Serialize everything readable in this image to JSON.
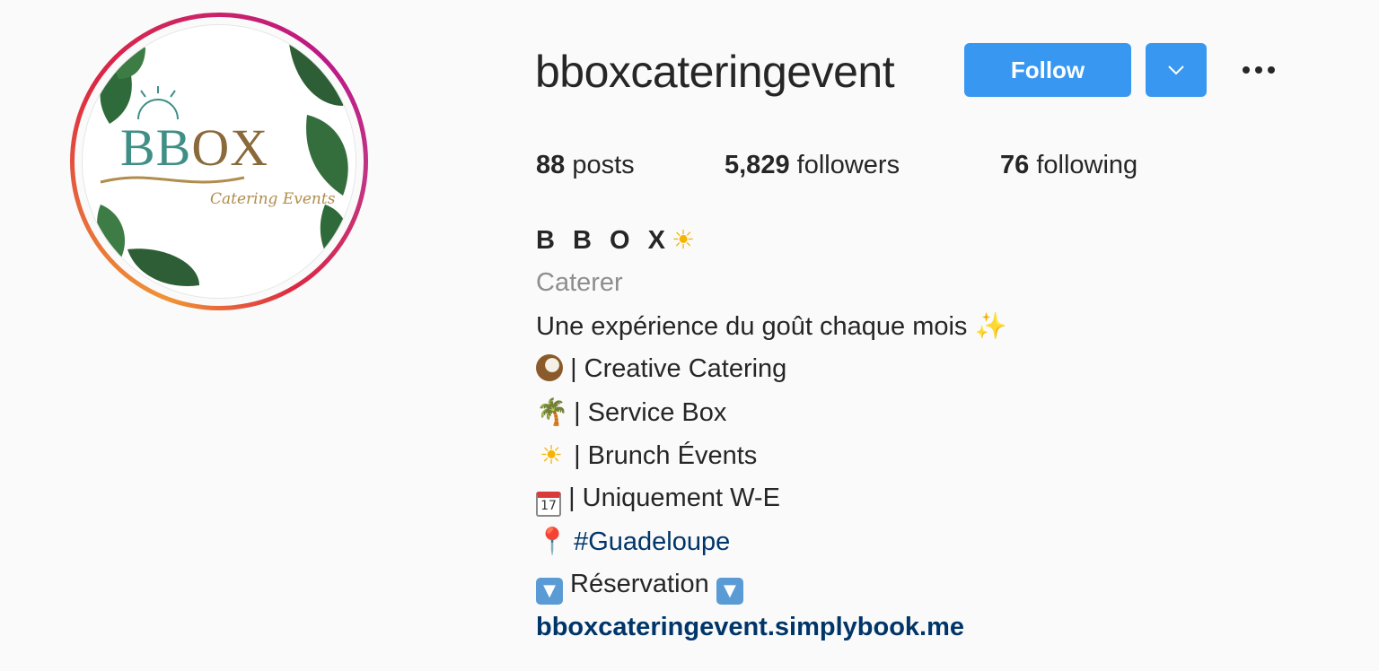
{
  "profile": {
    "username": "bboxcateringevent",
    "avatar": {
      "logo_text_main": "BB",
      "logo_text_accent": "OX",
      "logo_subtitle": "Catering Events",
      "description": "tropical leaves logo"
    }
  },
  "actions": {
    "follow_label": "Follow",
    "dropdown_icon": "chevron-down-icon",
    "more_icon": "more-options-icon",
    "accent_color": "#3897f0"
  },
  "stats": {
    "posts_count": "88",
    "posts_label": "posts",
    "followers_count": "5,829",
    "followers_label": "followers",
    "following_count": "76",
    "following_label": "following"
  },
  "bio": {
    "name": "B B O X",
    "name_emoji": "☀",
    "category": "Caterer",
    "line1_text": "Une expérience du goût chaque mois ",
    "line1_emoji": "✨",
    "line2_icon": "coconut-icon",
    "line2_text": "| Creative Catering",
    "line3_emoji": "🌴",
    "line3_text": "| Service Box",
    "line4_emoji": "☀",
    "line4_text": "| Brunch Évents",
    "line5_cal_day": "17",
    "line5_text": "| Uniquement W-E",
    "line6_emoji": "📍",
    "line6_hashtag": "#Guadeloupe",
    "line7_arrow": "▼",
    "line7_text": " Réservation ",
    "website": "bboxcateringevent.simplybook.me"
  }
}
